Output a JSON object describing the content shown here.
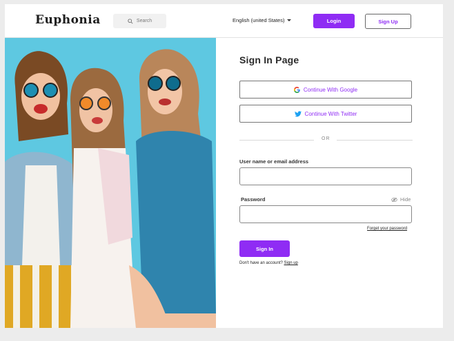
{
  "header": {
    "logo_text": "Euphonia",
    "search_placeholder": "Search",
    "language": "English (united States)",
    "login_label": "Login",
    "signup_label": "Sign Up"
  },
  "form": {
    "title": "Sign In Page",
    "google_label": "Continue With Google",
    "twitter_label": "Continue With Twitter",
    "divider_text": "OR",
    "username_label": "User name or email address",
    "username_value": "",
    "password_label": "Password",
    "password_value": "",
    "hide_label": "Hide",
    "forgot_label": "Forget your password",
    "signin_label": "Sign In",
    "no_account_text": "Don't have an account?",
    "signup_link": "Sign up"
  },
  "colors": {
    "accent": "#8f2cf4",
    "twitter": "#1da1f2",
    "photo_background": "#5dc6df"
  },
  "icons": [
    "search-icon",
    "chevron-down-icon",
    "google-icon",
    "twitter-icon",
    "eye-slash-icon"
  ]
}
